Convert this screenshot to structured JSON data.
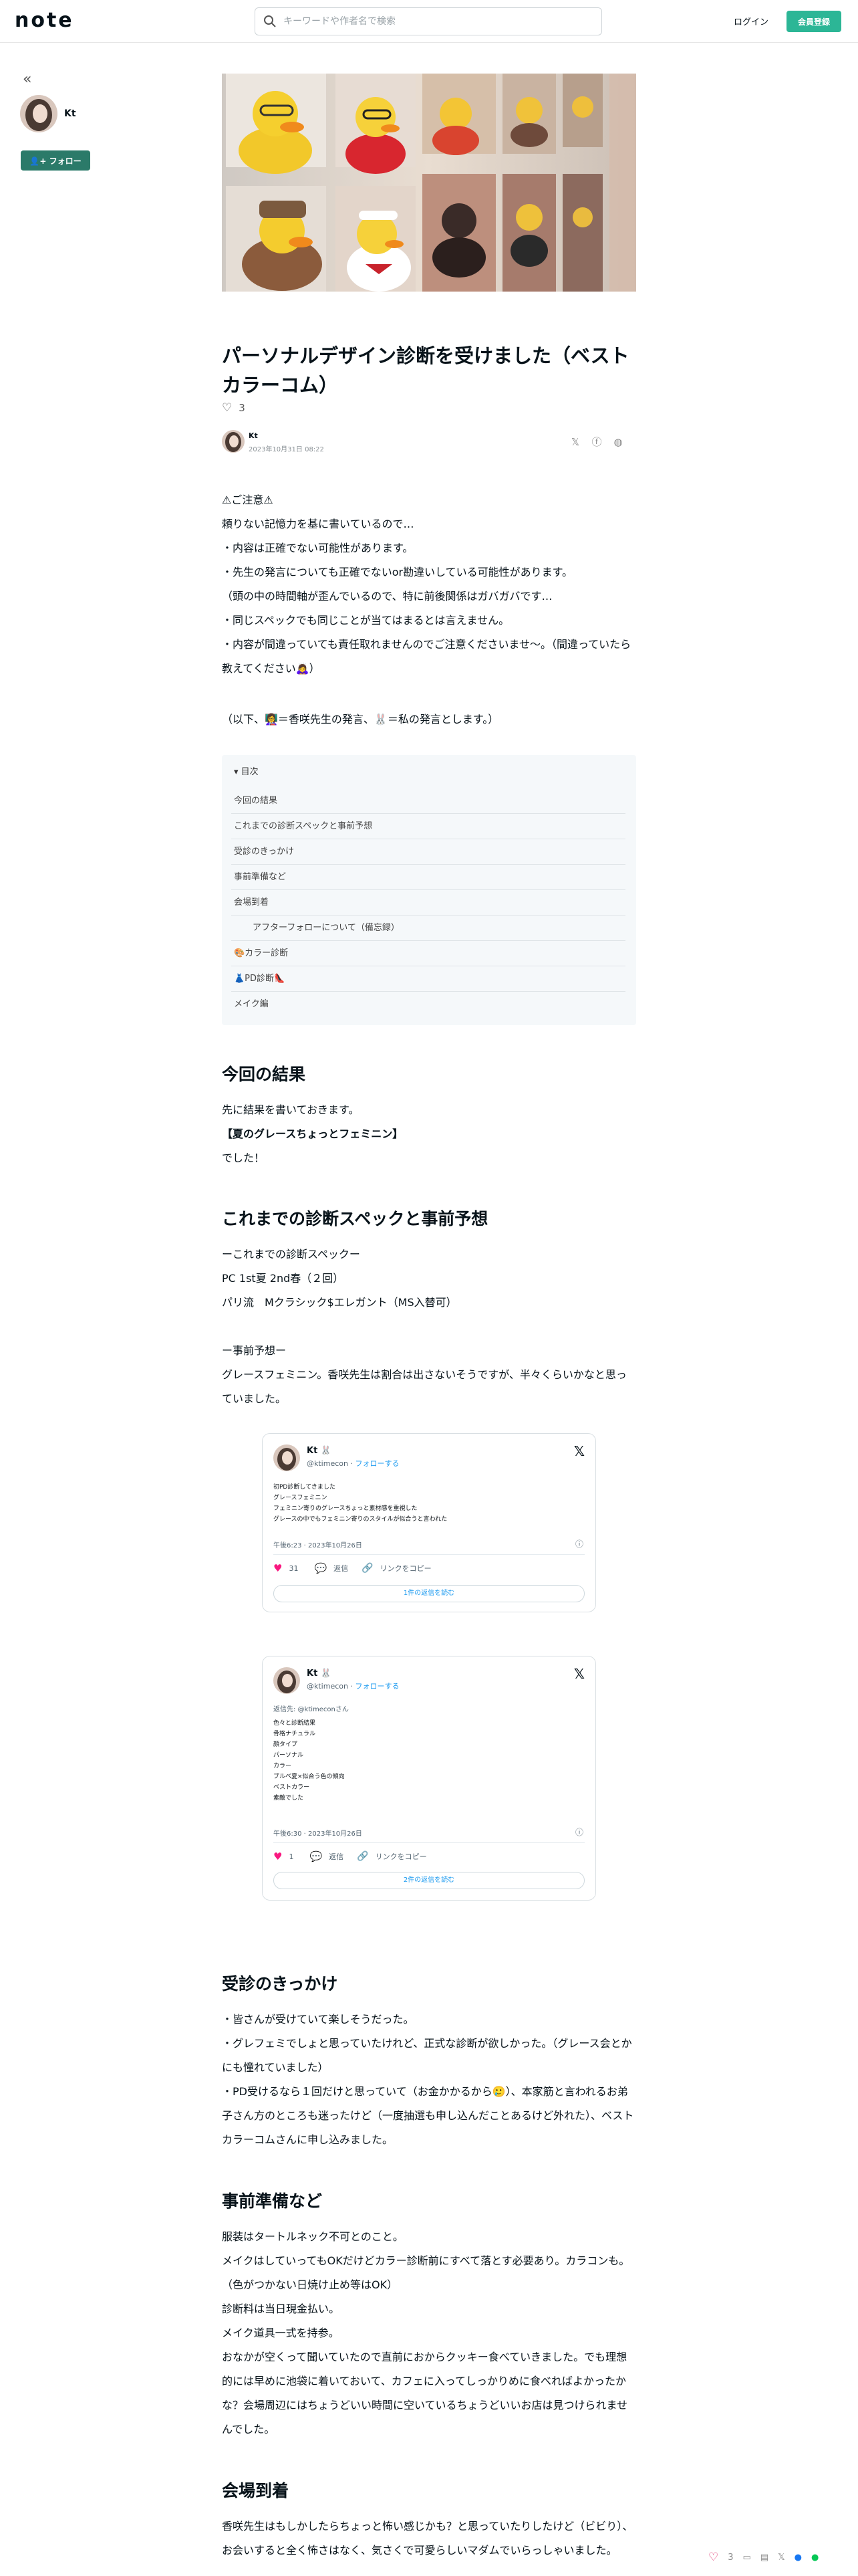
{
  "header": {
    "logo": "note",
    "search_placeholder": "キーワードや作者名で検索",
    "login_label": "ログイン",
    "signup_label": "会員登録"
  },
  "sidebar": {
    "collapse_glyph": "«",
    "author_name": "Kt",
    "follow_label": "フォロー"
  },
  "article": {
    "title": "パーソナルデザイン診断を受けました（ベストカラーコム）",
    "like_count": "3",
    "byline_name": "Kt",
    "byline_date": "2023年10月31日 08:22",
    "notice": [
      "⚠ご注意⚠",
      "頼りない記憶力を基に書いているので…",
      "・内容は正確でない可能性があります。",
      "・先生の発言についても正確でないor勘違いしている可能性があります。",
      "（頭の中の時間軸が歪んでいるので、特に前後関係はガバガバです…",
      "・同じスペックでも同じことが当てはまるとは言えません。",
      "・内容が間違っていても責任取れませんのでご注意くださいませ〜。（間違っていたら教えてください🙇‍♀️）"
    ],
    "legend": "（以下、👩‍🏫＝香咲先生の発言、🐰＝私の発言とします。）",
    "toc": {
      "heading": "目次",
      "items": [
        {
          "label": "今回の結果",
          "sub": false
        },
        {
          "label": "これまでの診断スペックと事前予想",
          "sub": false
        },
        {
          "label": "受診のきっかけ",
          "sub": false
        },
        {
          "label": "事前準備など",
          "sub": false
        },
        {
          "label": "会場到着",
          "sub": false
        },
        {
          "label": "アフターフォローについて（備忘録）",
          "sub": true
        },
        {
          "label": "🎨カラー診断",
          "sub": false
        },
        {
          "label": "👗PD診断👠",
          "sub": false
        },
        {
          "label": "メイク編",
          "sub": false
        }
      ]
    },
    "sec1": {
      "heading": "今回の結果",
      "lines": [
        "先に結果を書いておきます。",
        "【夏のグレースちょっとフェミニン】",
        "でした！"
      ]
    },
    "sec2": {
      "heading": "これまでの診断スペックと事前予想",
      "lines": [
        "ーこれまでの診断スペックー",
        "PC 1st夏 2nd春（２回）",
        "パリ流　Mクラシック$エレガント（MS入替可）",
        "",
        "ー事前予想ー",
        "グレースフェミニン。香咲先生は割合は出さないそうですが、半々くらいかなと思っていました。"
      ]
    },
    "tweets": [
      {
        "name": "Kt 🐰",
        "handle": "@ktimecon",
        "follow": "フォローする",
        "lines": [
          "初PD診断してきました",
          "グレースフェミニン",
          "フェミニン寄りのグレースちょっと素材感を重視した",
          "グレースの中でもフェミニン寄りのスタイルが似合うと言われた"
        ],
        "time": "午後6:23 · 2023年10月26日",
        "likes": "31",
        "reply": "返信",
        "copy": "リンクをコピー",
        "more": "1件の返信を読む"
      },
      {
        "name": "Kt 🐰",
        "handle": "@ktimecon",
        "follow": "フォローする",
        "reply_to": "返信先: @ktimeconさん",
        "lines": [
          "色々と診断結果",
          "骨格ナチュラル",
          "顔タイプ",
          "パーソナル",
          "カラー",
          "ブルベ夏×似合う色の傾向",
          "ベストカラー",
          "素敵でした"
        ],
        "time": "午後6:30 · 2023年10月26日",
        "likes": "1",
        "reply": "返信",
        "copy": "リンクをコピー",
        "more": "2件の返信を読む"
      }
    ],
    "sec3": {
      "heading": "受診のきっかけ",
      "lines": [
        "・皆さんが受けていて楽しそうだった。",
        "・グレフェミでしょと思っていたけれど、正式な診断が欲しかった。（グレース会とかにも憧れていました）",
        "・PD受けるなら１回だけと思っていて（お金かかるから🥲）、本家筋と言われるお弟子さん方のところも迷ったけど（一度抽選も申し込んだことあるけど外れた）、ベストカラーコムさんに申し込みました。"
      ]
    },
    "sec4": {
      "heading": "事前準備など",
      "lines": [
        "服装はタートルネック不可とのこと。",
        "メイクはしていってもOKだけどカラー診断前にすべて落とす必要あり。カラコンも。（色がつかない日焼け止め等はOK）",
        "診断料は当日現金払い。",
        "メイク道具一式を持参。",
        "おなかが空くって聞いていたので直前におからクッキー食べていきました。でも理想的には早めに池袋に着いておいて、カフェに入ってしっかりめに食べればよかったかな？会場周辺にはちょうどいい時間に空いているちょうどいいお店は見つけられませんでした。"
      ]
    },
    "sec5": {
      "heading": "会場到着",
      "lines": [
        "香咲先生はもしかしたらちょっと怖い感じかも？と思っていたりしたけど（ビビり）、お会いすると全く怖さはなく、気さくで可愛らしいマダムでいらっしゃいました。"
      ]
    }
  },
  "float_bar": {
    "likes": "3"
  }
}
